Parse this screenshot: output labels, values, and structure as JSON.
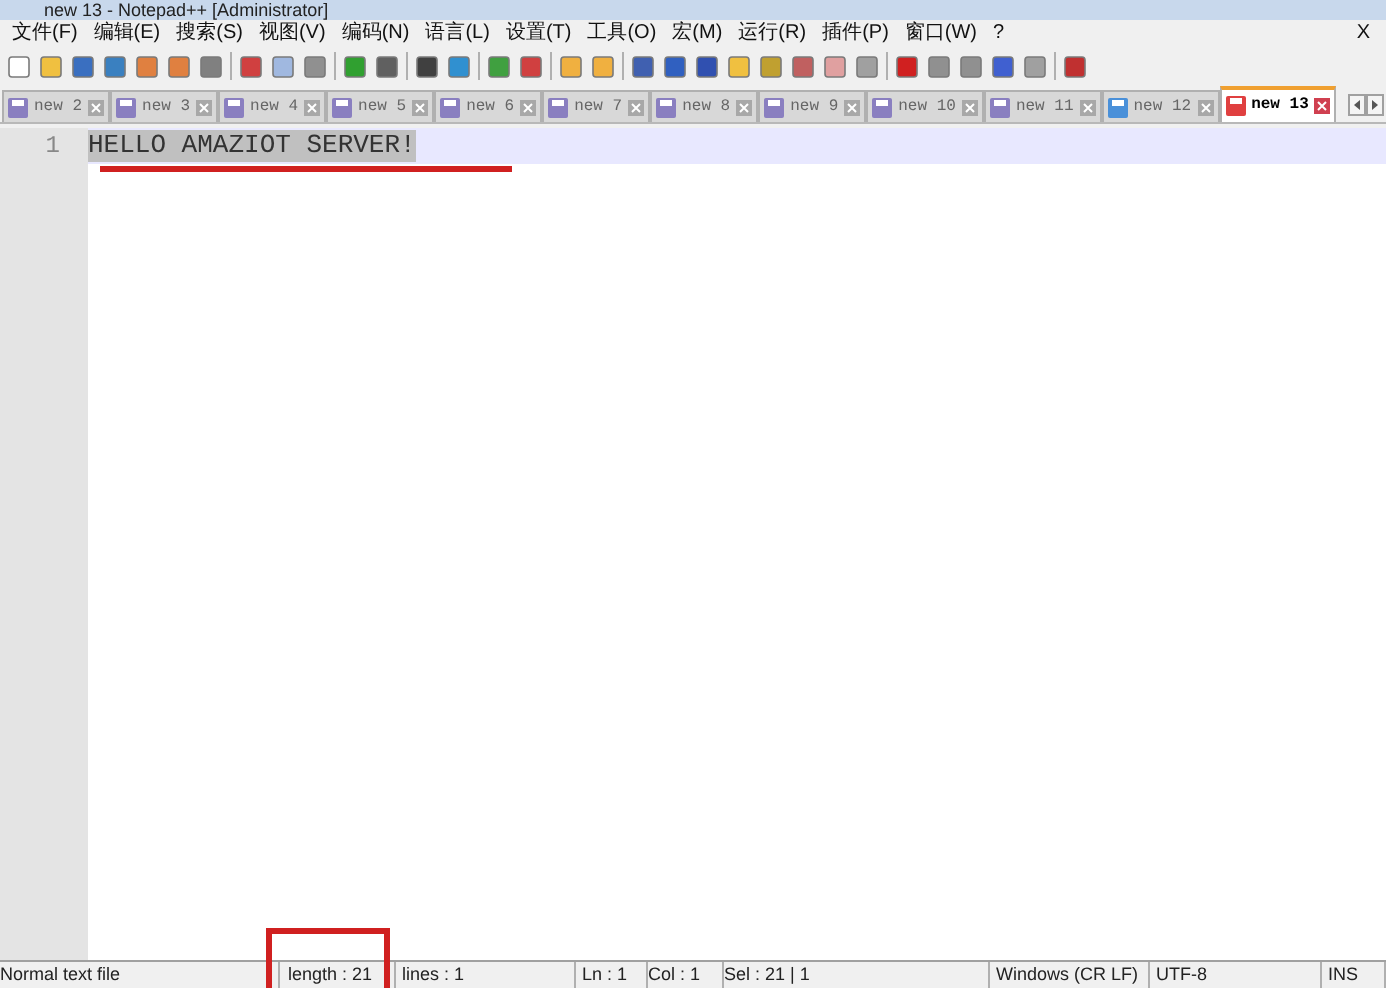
{
  "window": {
    "title": "new 13 - Notepad++ [Administrator]"
  },
  "menu": {
    "items": [
      "文件(F)",
      "编辑(E)",
      "搜索(S)",
      "视图(V)",
      "编码(N)",
      "语言(L)",
      "设置(T)",
      "工具(O)",
      "宏(M)",
      "运行(R)",
      "插件(P)",
      "窗口(W)",
      "?"
    ],
    "close": "X"
  },
  "tabs": [
    {
      "label": "new 2",
      "selected": false,
      "color": "#8a7fc0"
    },
    {
      "label": "new 3",
      "selected": false,
      "color": "#8a7fc0"
    },
    {
      "label": "new 4",
      "selected": false,
      "color": "#8a7fc0"
    },
    {
      "label": "new 5",
      "selected": false,
      "color": "#8a7fc0"
    },
    {
      "label": "new 6",
      "selected": false,
      "color": "#8a7fc0"
    },
    {
      "label": "new 7",
      "selected": false,
      "color": "#8a7fc0"
    },
    {
      "label": "new 8",
      "selected": false,
      "color": "#8a7fc0"
    },
    {
      "label": "new 9",
      "selected": false,
      "color": "#8a7fc0"
    },
    {
      "label": "new 10",
      "selected": false,
      "color": "#8a7fc0"
    },
    {
      "label": "new 11",
      "selected": false,
      "color": "#8a7fc0"
    },
    {
      "label": "new 12",
      "selected": false,
      "color": "#4a90d9"
    },
    {
      "label": "new 13",
      "selected": true,
      "color": "#e04040"
    }
  ],
  "editor": {
    "lines": [
      {
        "number": "1",
        "text": "HELLO AMAZIOT SERVER!",
        "selected": true
      }
    ]
  },
  "status_bar": {
    "cells": [
      "Normal text file",
      "length : 21",
      "lines : 1",
      "Ln : 1",
      "Col : 1",
      "Sel : 21 | 1",
      "Windows (CR LF)",
      "UTF-8",
      "INS"
    ]
  }
}
